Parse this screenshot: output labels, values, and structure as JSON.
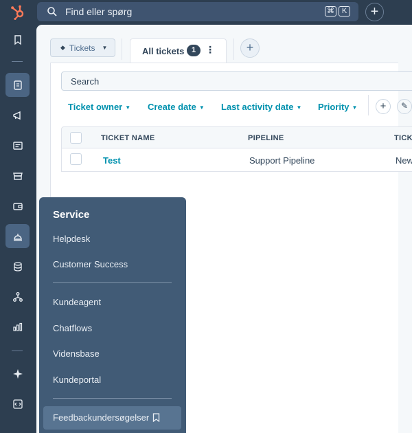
{
  "topbar": {
    "search_placeholder": "Find eller spørg",
    "shortcut_keys": [
      "⌘",
      "K"
    ],
    "add_label": "+"
  },
  "rail": {
    "icons": [
      "bookmark-icon",
      "contacts-icon",
      "marketing-icon",
      "content-icon",
      "commerce-icon",
      "wallet-icon",
      "service-bell-icon",
      "database-icon",
      "workflow-icon",
      "reports-icon",
      "ai-sparkle-icon",
      "developer-icon"
    ]
  },
  "view": {
    "object_selector": "Tickets",
    "tab_label": "All tickets",
    "tab_count": "1",
    "tab_more": "⋮",
    "add_tab": "+"
  },
  "search": {
    "placeholder": "Search"
  },
  "filters": [
    {
      "label": "Ticket owner"
    },
    {
      "label": "Create date"
    },
    {
      "label": "Last activity date"
    },
    {
      "label": "Priority"
    }
  ],
  "filter_actions": {
    "add": "+",
    "edit": "✎"
  },
  "table": {
    "columns": [
      "TICKET NAME",
      "PIPELINE",
      "TICKE"
    ],
    "rows": [
      {
        "name": "Test",
        "pipeline": "Support Pipeline",
        "status": "New"
      }
    ]
  },
  "service_menu": {
    "title": "Service",
    "group1": [
      "Helpdesk",
      "Customer Success"
    ],
    "group2": [
      "Kundeagent",
      "Chatflows",
      "Vidensbase",
      "Kundeportal"
    ],
    "highlighted": "Feedbackundersøgelser"
  },
  "colors": {
    "nav_bg": "#2d3e50",
    "popup_bg": "#415b76",
    "accent_link": "#0091ae",
    "logo": "#ff7a59"
  }
}
